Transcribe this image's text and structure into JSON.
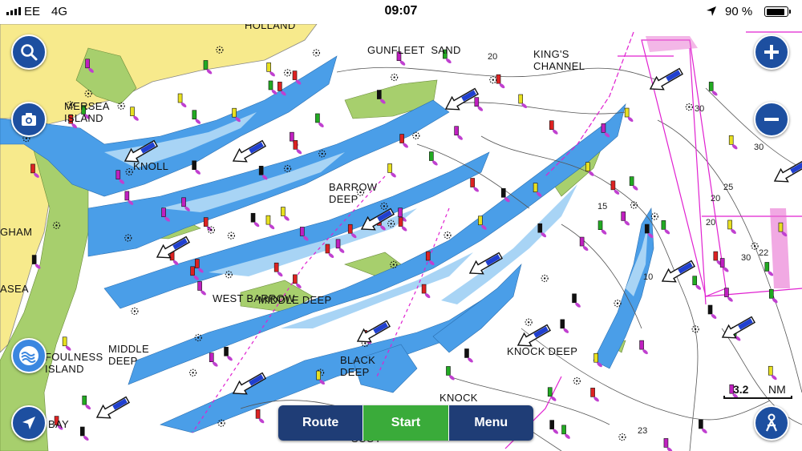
{
  "status_bar": {
    "carrier": "EE",
    "network": "4G",
    "time": "09:07",
    "battery_percent": "90 %",
    "battery_level": 0.9
  },
  "map": {
    "place_labels": {
      "holland": "HOLLAND",
      "gunfleet_sand": "GUNFLEET  SAND",
      "kings_channel": "KING'S\nCHANNEL",
      "mersea_island": "MERSEA\nISLAND",
      "knoll": "KNOLL",
      "barrow_deep": "BARROW\nDEEP",
      "gham": "GHAM",
      "asea": "ASEA",
      "west_barrow": "WEST BARROW",
      "middle_deep_mid": "MIDDLE DEEP",
      "foulness_island": "FOULNESS\nISLAND",
      "middle_deep_left": "MIDDLE\nDEEP",
      "black_deep": "BLACK\nDEEP",
      "knock_deep": "KNOCK DEEP",
      "knock": "KNOCK",
      "bay": "BAY",
      "scot": "SCOT"
    },
    "depth_labels": {
      "d30a": "30",
      "d30b": "30",
      "d25": "25",
      "d20a": "20",
      "d20b": "20",
      "d30c": "30",
      "d22": "22",
      "d15": "15",
      "d10": "10",
      "d23": "23",
      "d20c": "20"
    },
    "colors": {
      "land": "#f7ea8c",
      "intertidal": "#a7cf6d",
      "shallow": "#4a9ee8",
      "medium": "#a8d4f5",
      "deep": "#ffffff",
      "route_lines": "#e020d0"
    }
  },
  "controls": {
    "search_label": "search",
    "camera_label": "camera",
    "layers_label": "layers",
    "locate_label": "locate",
    "zoom_in_label": "zoom in",
    "zoom_out_label": "zoom out",
    "person_label": "profile"
  },
  "bottom_bar": {
    "route_label": "Route",
    "start_label": "Start",
    "menu_label": "Menu"
  },
  "scale": {
    "value": "3.2",
    "unit": "NM"
  }
}
